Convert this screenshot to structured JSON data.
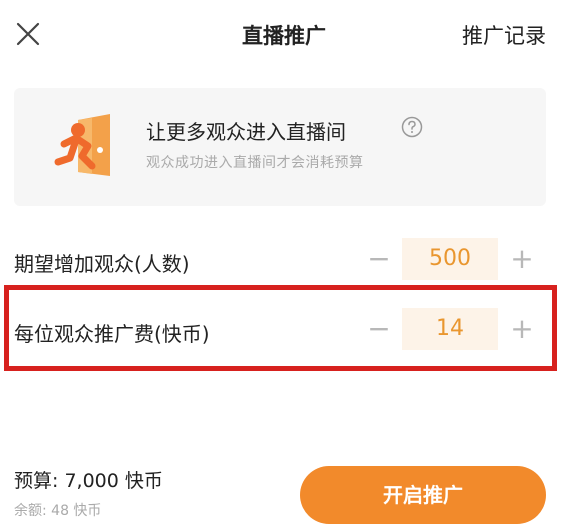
{
  "header": {
    "title": "直播推广",
    "records_label": "推广记录",
    "close_icon": "close-icon"
  },
  "promo_card": {
    "title": "让更多观众进入直播间",
    "subtitle": "观众成功进入直播间才会消耗预算",
    "icon": "running-person-door-icon",
    "help_icon": "question-circle-icon"
  },
  "fields": [
    {
      "label": "期望增加观众(人数)",
      "value": "500",
      "minus": "−",
      "plus": "+"
    },
    {
      "label": "每位观众推广费(快币)",
      "value": "14",
      "minus": "−",
      "plus": "+"
    }
  ],
  "footer": {
    "budget": "预算: 7,000 快币",
    "balance": "余额: 48 快币",
    "start_button": "开启推广"
  },
  "colors": {
    "accent": "#f28a2b",
    "value_text": "#e9962f",
    "value_bg": "#fdf3e8",
    "highlight": "#d7211e"
  }
}
